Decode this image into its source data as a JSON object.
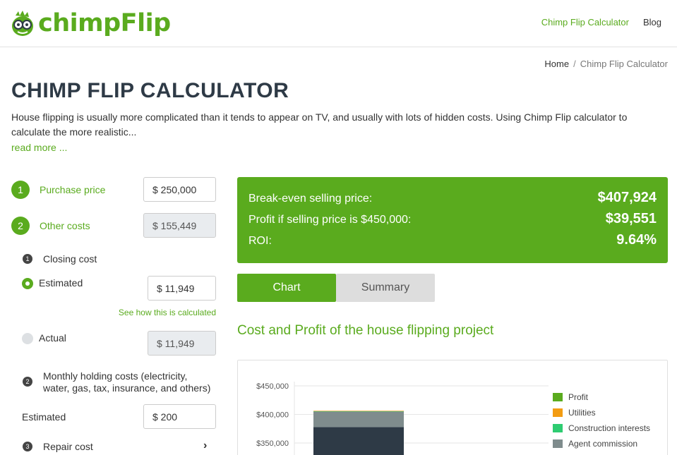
{
  "header": {
    "logo_text": "chimpFlip",
    "nav": [
      {
        "label": "Chimp Flip Calculator"
      },
      {
        "label": "Blog"
      }
    ]
  },
  "breadcrumb": {
    "home": "Home",
    "separator": "/",
    "current": "Chimp Flip Calculator"
  },
  "page": {
    "title": "CHIMP FLIP CALCULATOR",
    "intro": "House flipping is usually more complicated than it tends to appear on TV, and usually with lots of hidden costs. Using Chimp Flip calculator to calculate the more realistic...",
    "read_more": "read more ..."
  },
  "form": {
    "purchase": {
      "num": "1",
      "label": "Purchase price",
      "value": "$ 250,000"
    },
    "other": {
      "num": "2",
      "label": "Other costs",
      "value": "$ 155,449"
    },
    "closing": {
      "num": "1",
      "label": "Closing cost",
      "estimated_label": "Estimated",
      "estimated_value": "$ 11,949",
      "see_how": "See how this is calculated",
      "actual_label": "Actual",
      "actual_value": "$ 11,949"
    },
    "holding": {
      "num": "2",
      "label_line1": "Monthly holding costs (electricity,",
      "label_line2": "water, gas, tax, insurance, and others)",
      "estimated_label": "Estimated",
      "estimated_value": "$ 200"
    },
    "repair": {
      "num": "3",
      "label": "Repair cost",
      "chevron": "›"
    }
  },
  "results": {
    "breakeven_label": "Break-even selling price:",
    "breakeven_value": "$407,924",
    "profit_label": "Profit if selling price is $450,000:",
    "profit_value": "$39,551",
    "roi_label": "ROI:",
    "roi_value": "9.64%"
  },
  "tabs": [
    {
      "label": "Chart",
      "active": true
    },
    {
      "label": "Summary",
      "active": false
    }
  ],
  "chart_title": "Cost and Profit of the house flipping project",
  "colors": {
    "brand": "#5aab1e",
    "dark_bar": "#2e3a46",
    "gray_bar": "#7f8c8d",
    "utilities": "#f39c12",
    "construction": "#2ecc71"
  },
  "chart_data": {
    "type": "bar",
    "stacked": true,
    "ylim": [
      330000,
      460000
    ],
    "yticks": [
      "$450,000",
      "$400,000",
      "$350,000"
    ],
    "ytick_values": [
      450000,
      400000,
      350000
    ],
    "series": [
      {
        "name": "Profit",
        "color": "#5aab1e",
        "values": [
          0
        ]
      },
      {
        "name": "Utilities",
        "color": "#f39c12",
        "values": [
          800
        ]
      },
      {
        "name": "Construction interests",
        "color": "#2ecc71",
        "values": [
          600
        ]
      },
      {
        "name": "Agent commission",
        "color": "#7f8c8d",
        "values": [
          27000
        ]
      }
    ],
    "base_value": 378000,
    "legend_position": "right"
  }
}
